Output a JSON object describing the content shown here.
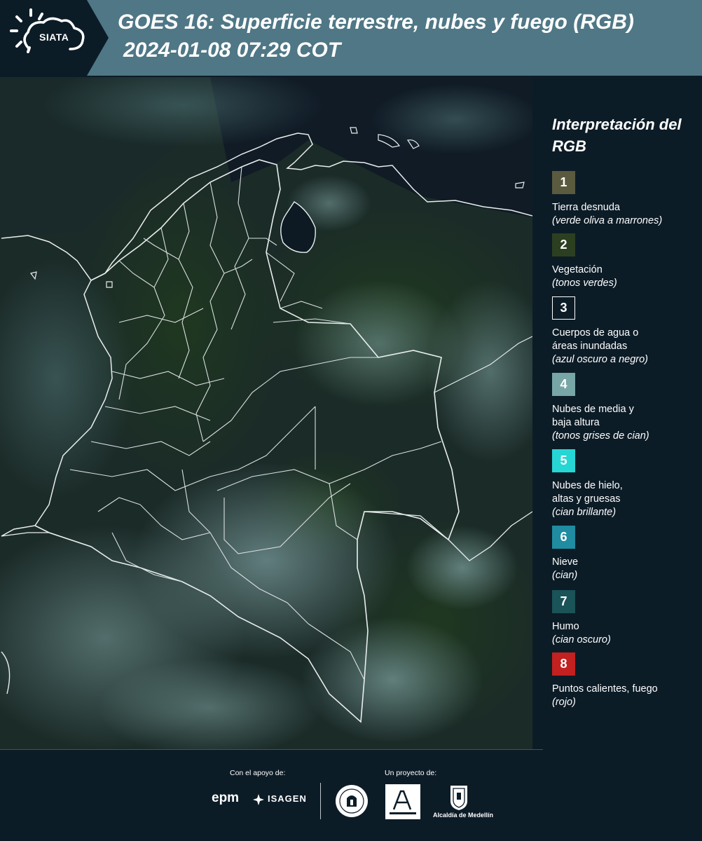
{
  "header": {
    "logo_text": "SIATA",
    "title": "GOES 16: Superficie terrestre, nubes y fuego (RGB)",
    "subtitle": "2024-01-08 07:29 COT"
  },
  "legend": {
    "title": "Interpretación del RGB",
    "items": [
      {
        "number": "1",
        "label": "Tierra desnuda",
        "note": "(verde oliva a marrones)",
        "color": "#5a5a3f"
      },
      {
        "number": "2",
        "label": "Vegetación",
        "note": "(tonos verdes)",
        "color": "#2c4021"
      },
      {
        "number": "3",
        "label": "Cuerpos de agua o\náreas inundadas",
        "note": "(azul oscuro a negro)",
        "color": "#0c1c27"
      },
      {
        "number": "4",
        "label": "Nubes de media y\nbaja altura",
        "note": "(tonos grises de cian)",
        "color": "#78a6a6"
      },
      {
        "number": "5",
        "label": "Nubes de hielo,\naltas y gruesas",
        "note": "(cian brillante)",
        "color": "#26d6d4"
      },
      {
        "number": "6",
        "label": "Nieve",
        "note": "(cian)",
        "color": "#1f8ca1"
      },
      {
        "number": "7",
        "label": "Humo",
        "note": "(cian oscuro)",
        "color": "#1a5358"
      },
      {
        "number": "8",
        "label": "Puntos calientes, fuego",
        "note": "(rojo)",
        "color": "#c32020"
      }
    ]
  },
  "footer": {
    "support_label": "Con el apoyo de:",
    "project_label": "Un proyecto de:",
    "epm_text": "epm",
    "isagen_text": "ISAGEN",
    "alcaldia_text": "Alcaldía de Medellín"
  }
}
